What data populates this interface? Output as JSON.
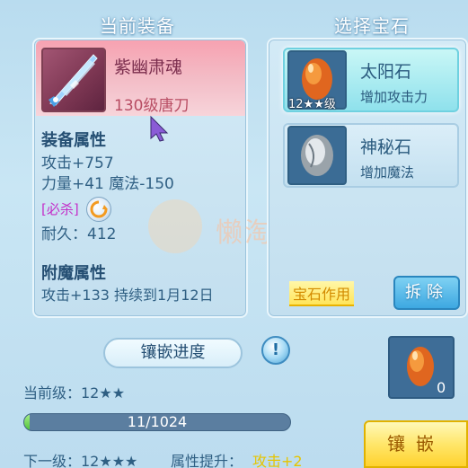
{
  "headers": {
    "left_title": "当前装备",
    "right_title": "选择宝石"
  },
  "equipment": {
    "name": "紫幽肃魂",
    "level": "130级唐刀",
    "attr_title": "装备属性",
    "attack": "攻击+757",
    "stats": "力量+41 魔法-150",
    "special_tag": "[必杀]",
    "durability": "耐久：412",
    "enchant_title": "附魔属性",
    "enchant_line": "攻击+133 持续到1月12日"
  },
  "gems": [
    {
      "name": "太阳石",
      "desc": "增加攻击力",
      "level_badge": "12★★级",
      "icon": "sun-stone-icon",
      "selected": true
    },
    {
      "name": "神秘石",
      "desc": "增加魔法",
      "icon": "mystery-stone-icon",
      "selected": false
    }
  ],
  "gem_effect_label": "宝石作用",
  "remove_button": "拆除",
  "progress": {
    "title": "镶嵌进度",
    "current_level": "当前级：12★★",
    "bar_text": "11/1024",
    "fraction": 0.0107,
    "next_level": "下一级：12★★★",
    "attr_boost_label": "属性提升：",
    "attr_boost_value": "攻击+2"
  },
  "slot_count": "0",
  "inlay_button": "镶嵌",
  "watermark": "懒淘淘",
  "colors": {
    "accent_yellow": "#ffd22e",
    "bar_fill": "#4fc237",
    "highlight_pink": "#f7a2b1",
    "selected_cyan": "#8fe1ec"
  }
}
